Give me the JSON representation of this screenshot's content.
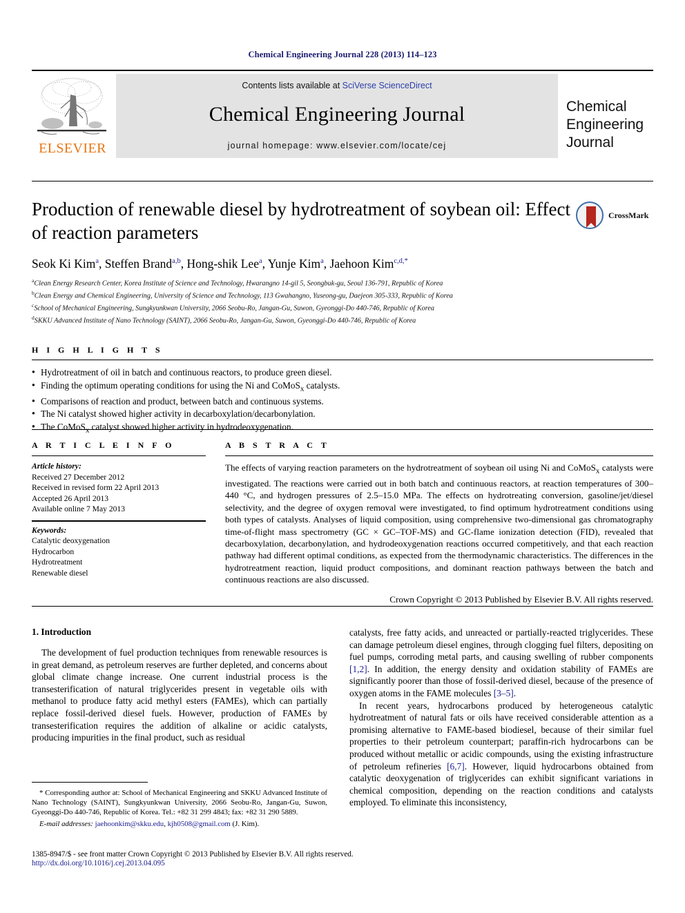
{
  "running_head": "Chemical Engineering Journal 228 (2013) 114–123",
  "masthead": {
    "contents_prefix": "Contents lists available at ",
    "sciencedirect": "SciVerse ScienceDirect",
    "journal_title": "Chemical Engineering Journal",
    "homepage": "journal homepage: www.elsevier.com/locate/cej",
    "publisher_wordmark": "ELSEVIER",
    "cover_line1": "Chemical",
    "cover_line2": "Engineering",
    "cover_line3": "Journal",
    "link_color": "#2b3fa8",
    "band_color": "#e3e3e3",
    "elsevier_orange": "#e87511"
  },
  "title": "Production of renewable diesel by hydrotreatment of soybean oil: Effect of reaction parameters",
  "crossmark": {
    "label": "CrossMark",
    "ribbon_color": "#b5261e",
    "ring_color": "#3e6fa8"
  },
  "authors": [
    {
      "name": "Seok Ki Kim",
      "sup": "a",
      "sep": ", "
    },
    {
      "name": "Steffen Brand",
      "sup": "a,b",
      "sep": ", "
    },
    {
      "name": "Hong-shik Lee",
      "sup": "a",
      "sep": ", "
    },
    {
      "name": "Yunje Kim",
      "sup": "a",
      "sep": ", "
    },
    {
      "name": "Jaehoon Kim",
      "sup": "c,d,*",
      "sep": ""
    }
  ],
  "affiliations": [
    {
      "mark": "a",
      "text": "Clean Energy Research Center, Korea Institute of Science and Technology, Hwarangno 14-gil 5, Seongbuk-gu, Seoul 136-791, Republic of Korea"
    },
    {
      "mark": "b",
      "text": "Clean Energy and Chemical Engineering, University of Science and Technology, 113 Gwahangno, Yuseong-gu, Daejeon 305-333, Republic of Korea"
    },
    {
      "mark": "c",
      "text": "School of Mechanical Engineering, Sungkyunkwan University, 2066 Seobu-Ro, Jangan-Gu, Suwon, Gyeonggi-Do 440-746, Republic of Korea"
    },
    {
      "mark": "d",
      "text": "SKKU Advanced Institute of Nano Technology (SAINT), 2066 Seobu-Ro, Jangan-Gu, Suwon, Gyeonggi-Do 440-746, Republic of Korea"
    }
  ],
  "highlights": {
    "label": "H I G H L I G H T S",
    "items": [
      "Hydrotreatment of oil in batch and continuous reactors, to produce green diesel.",
      "Finding the optimum operating conditions for using the Ni and CoMoSx catalysts.",
      "Comparisons of reaction and product, between batch and continuous systems.",
      "The Ni catalyst showed higher activity in decarboxylation/decarbonylation.",
      "The CoMoSx catalyst showed higher activity in hydrodeoxygenation."
    ]
  },
  "article_info": {
    "label": "A R T I C L E  I N F O",
    "history_title": "Article history:",
    "history": [
      "Received 27 December 2012",
      "Received in revised form 22 April 2013",
      "Accepted 26 April 2013",
      "Available online 7 May 2013"
    ],
    "keywords_title": "Keywords:",
    "keywords": [
      "Catalytic deoxygenation",
      "Hydrocarbon",
      "Hydrotreatment",
      "Renewable diesel"
    ]
  },
  "abstract": {
    "label": "A B S T R A C T",
    "body": "The effects of varying reaction parameters on the hydrotreatment of soybean oil using Ni and CoMoSx catalysts were investigated. The reactions were carried out in both batch and continuous reactors, at reaction temperatures of 300–440 °C, and hydrogen pressures of 2.5–15.0 MPa. The effects on hydrotreating conversion, gasoline/jet/diesel selectivity, and the degree of oxygen removal were investigated, to find optimum hydrotreatment conditions using both types of catalysts. Analyses of liquid composition, using comprehensive two-dimensional gas chromatography time-of-flight mass spectrometry (GC × GC–TOF-MS) and GC-flame ionization detection (FID), revealed that decarboxylation, decarbonylation, and hydrodeoxygenation reactions occurred competitively, and that each reaction pathway had different optimal conditions, as expected from the thermodynamic characteristics. The differences in the hydrotreatment reaction, liquid product compositions, and dominant reaction pathways between the batch and continuous reactions are also discussed.",
    "copyright": "Crown Copyright © 2013 Published by Elsevier B.V. All rights reserved."
  },
  "introduction": {
    "heading": "1. Introduction",
    "left_paragraph": "The development of fuel production techniques from renewable resources is in great demand, as petroleum reserves are further depleted, and concerns about global climate change increase. One current industrial process is the transesterification of natural triglycerides present in vegetable oils with methanol to produce fatty acid methyl esters (FAMEs), which can partially replace fossil-derived diesel fuels. However, production of FAMEs by transesterification requires the addition of alkaline or acidic catalysts, producing impurities in the final product, such as residual",
    "right_paragraph_1_a": "catalysts, free fatty acids, and unreacted or partially-reacted triglycerides. These can damage petroleum diesel engines, through clogging fuel filters, depositing on fuel pumps, corroding metal parts, and causing swelling of rubber components ",
    "right_paragraph_1_ref1": "[1,2]",
    "right_paragraph_1_b": ". In addition, the energy density and oxidation stability of FAMEs are significantly poorer than those of fossil-derived diesel, because of the presence of oxygen atoms in the FAME molecules ",
    "right_paragraph_1_ref2": "[3–5]",
    "right_paragraph_1_c": ".",
    "right_paragraph_2_a": "In recent years, hydrocarbons produced by heterogeneous catalytic hydrotreatment of natural fats or oils have received considerable attention as a promising alternative to FAME-based biodiesel, because of their similar fuel properties to their petroleum counterpart; paraffin-rich hydrocarbons can be produced without metallic or acidic compounds, using the existing infrastructure of petroleum refineries ",
    "right_paragraph_2_ref1": "[6,7]",
    "right_paragraph_2_b": ". However, liquid hydrocarbons obtained from catalytic deoxygenation of triglycerides can exhibit significant variations in chemical composition, depending on the reaction conditions and catalysts employed. To eliminate this inconsistency,"
  },
  "footnote": {
    "corresponding": "* Corresponding author at: School of Mechanical Engineering and SKKU Advanced Institute of Nano Technology (SAINT), Sungkyunkwan University, 2066 Seobu-Ro, Jangan-Gu, Suwon, Gyeonggi-Do 440-746, Republic of Korea. Tel.: +82 31 299 4843; fax: +82 31 290 5889.",
    "email_label": "E-mail addresses:",
    "email1": "jaehoonkim@skku.edu",
    "email2": "kjh0508@gmail.com",
    "email_suffix": "(J. Kim)."
  },
  "footer": {
    "line1": "1385-8947/$ - see front matter Crown Copyright © 2013 Published by Elsevier B.V. All rights reserved.",
    "line2": "http://dx.doi.org/10.1016/j.cej.2013.04.095"
  }
}
